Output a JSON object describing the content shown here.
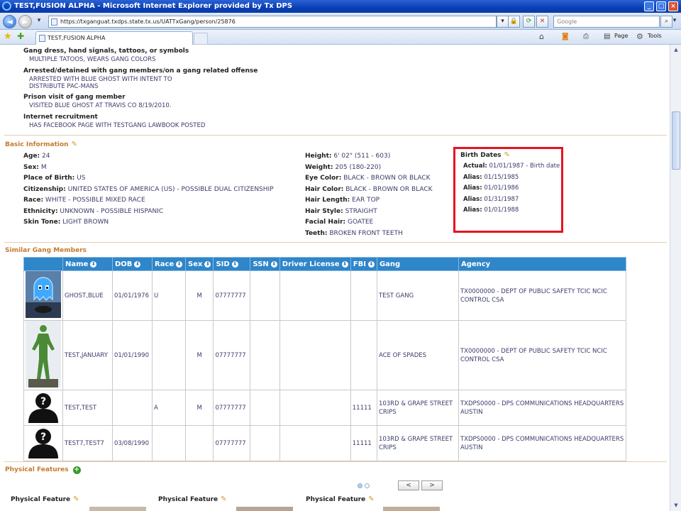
{
  "window": {
    "title": "TEST,FUSION ALPHA - Microsoft Internet Explorer provided by Tx DPS"
  },
  "address": {
    "url": "https://txganguat.txdps.state.tx.us/UATTxGang/person/25876",
    "search_placeholder": "Google"
  },
  "tab": {
    "label": "TEST,FUSION ALPHA"
  },
  "commands": {
    "page": "Page",
    "tools": "Tools"
  },
  "indicators": [
    {
      "heading": "Gang dress, hand signals, tattoos, or symbols",
      "lines": [
        "MULTIPLE TATOOS, WEARS GANG COLORS"
      ]
    },
    {
      "heading": "Arrested/detained with gang members/on a gang related offense",
      "lines": [
        "ARRESTED WITH BLUE GHOST WITH INTENT TO",
        "DISTRIBUTE PAC-MANS"
      ]
    },
    {
      "heading": "Prison visit of gang member",
      "lines": [
        "VISITED BLUE GHOST AT TRAVIS CO 8/19/2010."
      ]
    },
    {
      "heading": "Internet recruitment",
      "lines": [
        "HAS FACEBOOK PAGE WITH TESTGANG LAWBOOK POSTED"
      ]
    }
  ],
  "basic_info": {
    "title": "Basic Information",
    "left": [
      {
        "label": "Age:",
        "value": "24"
      },
      {
        "label": "Sex:",
        "value": "M"
      },
      {
        "label": "Place of Birth:",
        "value": "US"
      },
      {
        "label": "Citizenship:",
        "value": "UNITED STATES OF AMERICA (US) - POSSIBLE DUAL CITIZENSHIP"
      },
      {
        "label": "Race:",
        "value": "WHITE - POSSIBLE MIXED RACE"
      },
      {
        "label": "Ethnicity:",
        "value": "UNKNOWN - POSSIBLE HISPANIC"
      },
      {
        "label": "Skin Tone:",
        "value": "LIGHT BROWN"
      }
    ],
    "middle": [
      {
        "label": "Height:",
        "value": "6' 02\" (511 - 603)"
      },
      {
        "label": "Weight:",
        "value": "205 (180-220)"
      },
      {
        "label": "Eye Color:",
        "value": "BLACK - BROWN OR BLACK"
      },
      {
        "label": "Hair Color:",
        "value": "BLACK - BROWN OR BLACK"
      },
      {
        "label": "Hair Length:",
        "value": "EAR TOP"
      },
      {
        "label": "Hair Style:",
        "value": "STRAIGHT"
      },
      {
        "label": "Facial Hair:",
        "value": "GOATEE"
      },
      {
        "label": "Teeth:",
        "value": "BROKEN FRONT TEETH"
      }
    ]
  },
  "birth_dates": {
    "title": "Birth Dates",
    "rows": [
      {
        "label": "Actual:",
        "value": "01/01/1987 - Birth date"
      },
      {
        "label": "Alias:",
        "value": "01/15/1985"
      },
      {
        "label": "Alias:",
        "value": "01/01/1986"
      },
      {
        "label": "Alias:",
        "value": "01/31/1987"
      },
      {
        "label": "Alias:",
        "value": "01/01/1988"
      }
    ]
  },
  "similar": {
    "title": "Similar Gang Members",
    "columns": [
      "Name",
      "DOB",
      "Race",
      "Sex",
      "SID",
      "SSN",
      "Driver License",
      "FBI",
      "Gang",
      "Agency"
    ],
    "rows": [
      {
        "photo": "ghost",
        "name": "GHOST,BLUE",
        "dob": "01/01/1976",
        "race": "U",
        "sex": "M",
        "sid": "07777777",
        "ssn": "",
        "dl": "",
        "fbi": "",
        "gang": "TEST GANG",
        "agency": "TX0000000 - DEPT OF PUBLIC SAFETY TCIC NCIC CONTROL CSA"
      },
      {
        "photo": "statue",
        "name": "TEST,JANUARY",
        "dob": "01/01/1990",
        "race": "",
        "sex": "M",
        "sid": "07777777",
        "ssn": "",
        "dl": "",
        "fbi": "",
        "gang": "ACE OF SPADES",
        "agency": "TX0000000 - DEPT OF PUBLIC SAFETY TCIC NCIC CONTROL CSA"
      },
      {
        "photo": "unknown",
        "name": "TEST,TEST",
        "dob": "",
        "race": "A",
        "sex": "M",
        "sid": "07777777",
        "ssn": "",
        "dl": "",
        "fbi": "11111",
        "gang": "103RD & GRAPE STREET CRIPS",
        "agency": "TXDPS0000 - DPS COMMUNICATIONS HEADQUARTERS AUSTIN"
      },
      {
        "photo": "unknown",
        "name": "TEST7,TEST7",
        "dob": "03/08/1990",
        "race": "",
        "sex": "",
        "sid": "07777777",
        "ssn": "",
        "dl": "",
        "fbi": "11111",
        "gang": "103RD & GRAPE STREET CRIPS",
        "agency": "TXDPS0000 - DPS COMMUNICATIONS HEADQUARTERS AUSTIN"
      }
    ]
  },
  "physical": {
    "title": "Physical Features",
    "items": [
      "Physical Feature",
      "Physical Feature",
      "Physical Feature"
    ]
  },
  "pager": {
    "prev": "<",
    "next": ">"
  }
}
